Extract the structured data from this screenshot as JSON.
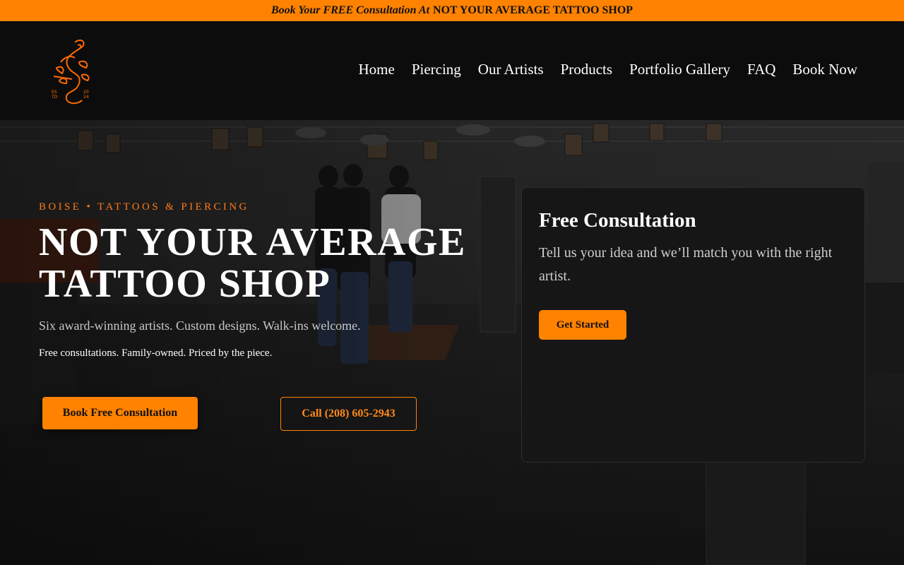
{
  "promo": {
    "italic_text": "Book Your FREE Consultation At",
    "bold_text": "NOT YOUR AVERAGE TATTOO SHOP"
  },
  "logo": {
    "year_top": "20",
    "year_bottom": "24",
    "est_top": "ES",
    "est_bottom": "TD",
    "accent": "#ff6a00"
  },
  "nav": {
    "items": [
      "Home",
      "Piercing",
      "Our Artists",
      "Products",
      "Portfolio Gallery",
      "FAQ",
      "Book Now"
    ]
  },
  "hero": {
    "eyebrow": "BOISE • TATTOOS & PIERCING",
    "title_line1": "NOT YOUR AVERAGE",
    "title_line2": "TATTOO SHOP",
    "subtitle": "Six award-winning artists. Custom designs. Walk-ins welcome.",
    "tagline": "Free consultations. Family-owned. Priced by the piece.",
    "primary_button": "Book Free Consultation",
    "phone_button": "Call (208) 605-2943"
  },
  "consult_card": {
    "title": "Free Consultation",
    "body": "Tell us your idea and we’ll match you with the right artist.",
    "cta": "Get Started"
  },
  "colors": {
    "accent": "#ff8200",
    "header_bg": "#0c0c0c",
    "card_bg": "#161616"
  }
}
